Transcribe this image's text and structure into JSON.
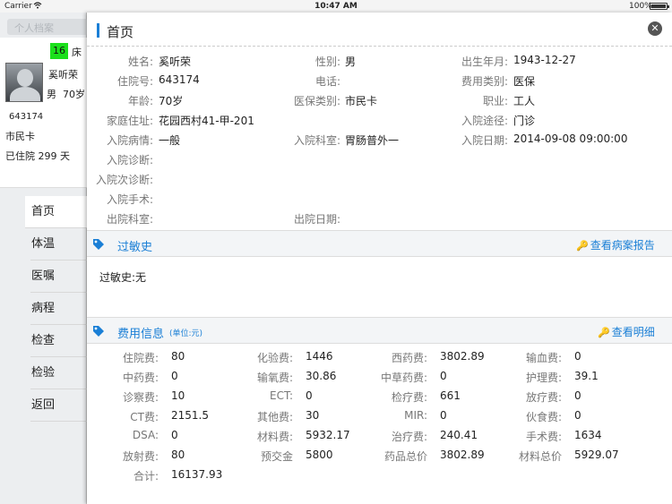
{
  "status_bar": {
    "carrier": "Carrier",
    "time": "10:47 AM",
    "battery": "100%"
  },
  "sidebar": {
    "ghost_tab": "个人档案",
    "patient": {
      "bed_number": "16",
      "bed_suffix": "床",
      "name": "奚听荣",
      "gender": "男",
      "age": "70岁",
      "id": "643174",
      "insurance": "市民卡",
      "days": "已住院 299 天"
    },
    "nav": [
      "首页",
      "体温",
      "医嘱",
      "病程",
      "检查",
      "检验",
      "返回"
    ],
    "active_nav": "首页"
  },
  "header": {
    "title": "首页"
  },
  "patient_info": {
    "name_label": "姓名:",
    "name": "奚听荣",
    "gender_label": "性别:",
    "gender": "男",
    "birth_label": "出生年月:",
    "birth": "1943-12-27",
    "admission_no_label": "住院号:",
    "admission_no": "643174",
    "phone_label": "电话:",
    "phone": "",
    "fee_type_label": "费用类别:",
    "fee_type": "医保",
    "age_label": "年龄:",
    "age": "70岁",
    "insurance_type_label": "医保类别:",
    "insurance_type": "市民卡",
    "occupation_label": "职业:",
    "occupation": "工人",
    "address_label": "家庭住址:",
    "address": "花园西村41-甲-201",
    "admission_route_label": "入院途径:",
    "admission_route": "门诊",
    "admission_condition_label": "入院病情:",
    "admission_condition": "一般",
    "admission_dept_label": "入院科室:",
    "admission_dept": "胃肠普外一",
    "admission_date_label": "入院日期:",
    "admission_date": "2014-09-08 09:00:00",
    "admission_diag_label": "入院诊断:",
    "admission_secondary_diag_label": "入院次诊断:",
    "admission_surgery_label": "入院手术:",
    "discharge_dept_label": "出院科室:",
    "discharge_date_label": "出院日期:"
  },
  "allergy": {
    "title": "过敏史",
    "link": "查看病案报告",
    "text": "过敏史:无"
  },
  "fees": {
    "title": "费用信息",
    "unit": "(单位:元)",
    "link": "查看明细",
    "rows": [
      [
        {
          "label": "住院费:",
          "value": "80"
        },
        {
          "label": "化验费:",
          "value": "1446"
        },
        {
          "label": "西药费:",
          "value": "3802.89"
        },
        {
          "label": "输血费:",
          "value": "0"
        }
      ],
      [
        {
          "label": "中药费:",
          "value": "0"
        },
        {
          "label": "输氧费:",
          "value": "30.86"
        },
        {
          "label": "中草药费:",
          "value": "0"
        },
        {
          "label": "护理费:",
          "value": "39.1"
        }
      ],
      [
        {
          "label": "诊察费:",
          "value": "10"
        },
        {
          "label": "ECT:",
          "value": "0"
        },
        {
          "label": "检疗费:",
          "value": "661"
        },
        {
          "label": "放疗费:",
          "value": "0"
        }
      ],
      [
        {
          "label": "CT费:",
          "value": "2151.5"
        },
        {
          "label": "其他费:",
          "value": "30"
        },
        {
          "label": "MIR:",
          "value": "0"
        },
        {
          "label": "伙食费:",
          "value": "0"
        }
      ],
      [
        {
          "label": "DSA:",
          "value": "0"
        },
        {
          "label": "材料费:",
          "value": "5932.17"
        },
        {
          "label": "治疗费:",
          "value": "240.41"
        },
        {
          "label": "手术费:",
          "value": "1634"
        }
      ],
      [
        {
          "label": "放射费:",
          "value": "80"
        },
        {
          "label": "预交金",
          "value": "5800"
        },
        {
          "label": "药品总价",
          "value": "3802.89"
        },
        {
          "label": "材料总价",
          "value": "5929.07"
        }
      ],
      [
        {
          "label": "合计:",
          "value": "16137.93"
        }
      ]
    ]
  },
  "colors": {
    "accent": "#1a7fd6",
    "bed_badge": "#1be01b"
  },
  "icons": {
    "close": "close-icon",
    "tag": "tag-icon",
    "key": "key-icon",
    "wifi": "wifi-icon"
  }
}
